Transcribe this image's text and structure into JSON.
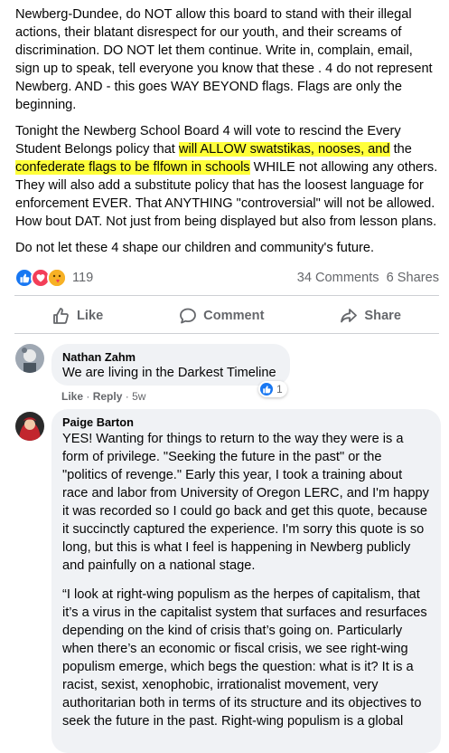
{
  "post": {
    "p1": "Newberg-Dundee, do NOT allow this board to stand with their illegal actions, their blatant disrespect for our youth, and their screams of discrimination. DO NOT let them continue. Write in, complain, email, sign up to speak, tell everyone you know that these . 4 do not represent Newberg. AND - this goes WAY BEYOND flags. Flags are only the beginning.",
    "p2_pre": "Tonight the Newberg School Board 4 will vote to rescind the Every Student Belongs policy that ",
    "p2_hl1": "will ALLOW swatstikas, nooses, and",
    "p2_mid": " the ",
    "p2_hl2": "confederate flags to be flfown in schools",
    "p2_post": " WHILE not allowing any others. They will also add a substitute policy that has the loosest language for enforcement EVER. That ANYTHING \"controversial\" will not be allowed. How bout DAT. Not just from being displayed but also from lesson plans.",
    "p3": "Do not let these 4 shape our children and community's future."
  },
  "reactions": {
    "count": "119",
    "comments": "34 Comments",
    "shares": "6 Shares",
    "icons": [
      "like-icon",
      "love-icon",
      "care-icon"
    ]
  },
  "actions": {
    "like": "Like",
    "comment": "Comment",
    "share": "Share"
  },
  "comments": [
    {
      "author": "Nathan Zahm",
      "text": "We are living in the Darkest Timeline",
      "like": "Like",
      "reply": "Reply",
      "age": "5w",
      "reaction_count": "1"
    },
    {
      "author": "Paige Barton",
      "p1": "YES! Wanting for things to return to the way they were is a form of privilege. \"Seeking the future in the past\" or the \"politics of revenge.\" Early this year, I took a training about race and labor from University of Oregon LERC, and I'm happy it was recorded so I could go back and get this quote, because it succinctly captured the experience. I'm sorry this quote is so long, but this is what I feel is happening in Newberg publicly and painfully on a national stage.",
      "p2": "“I look at right-wing populism as the herpes of capitalism, that it’s a virus in the capitalist system that surfaces and resurfaces depending on the kind of crisis that’s going on. Particularly when there’s an economic or fiscal crisis, we see right-wing populism emerge, which begs the question: what is it? It is a racist, sexist, xenophobic, irrationalist movement, very authoritarian both in terms of its structure and its objectives to seek the future in the past. Right-wing populism is a global"
    }
  ],
  "colors": {
    "like_blue": "#1877f2",
    "highlight": "#ffff3a",
    "bubble": "#f0f2f5",
    "secondary_text": "#65676b"
  }
}
